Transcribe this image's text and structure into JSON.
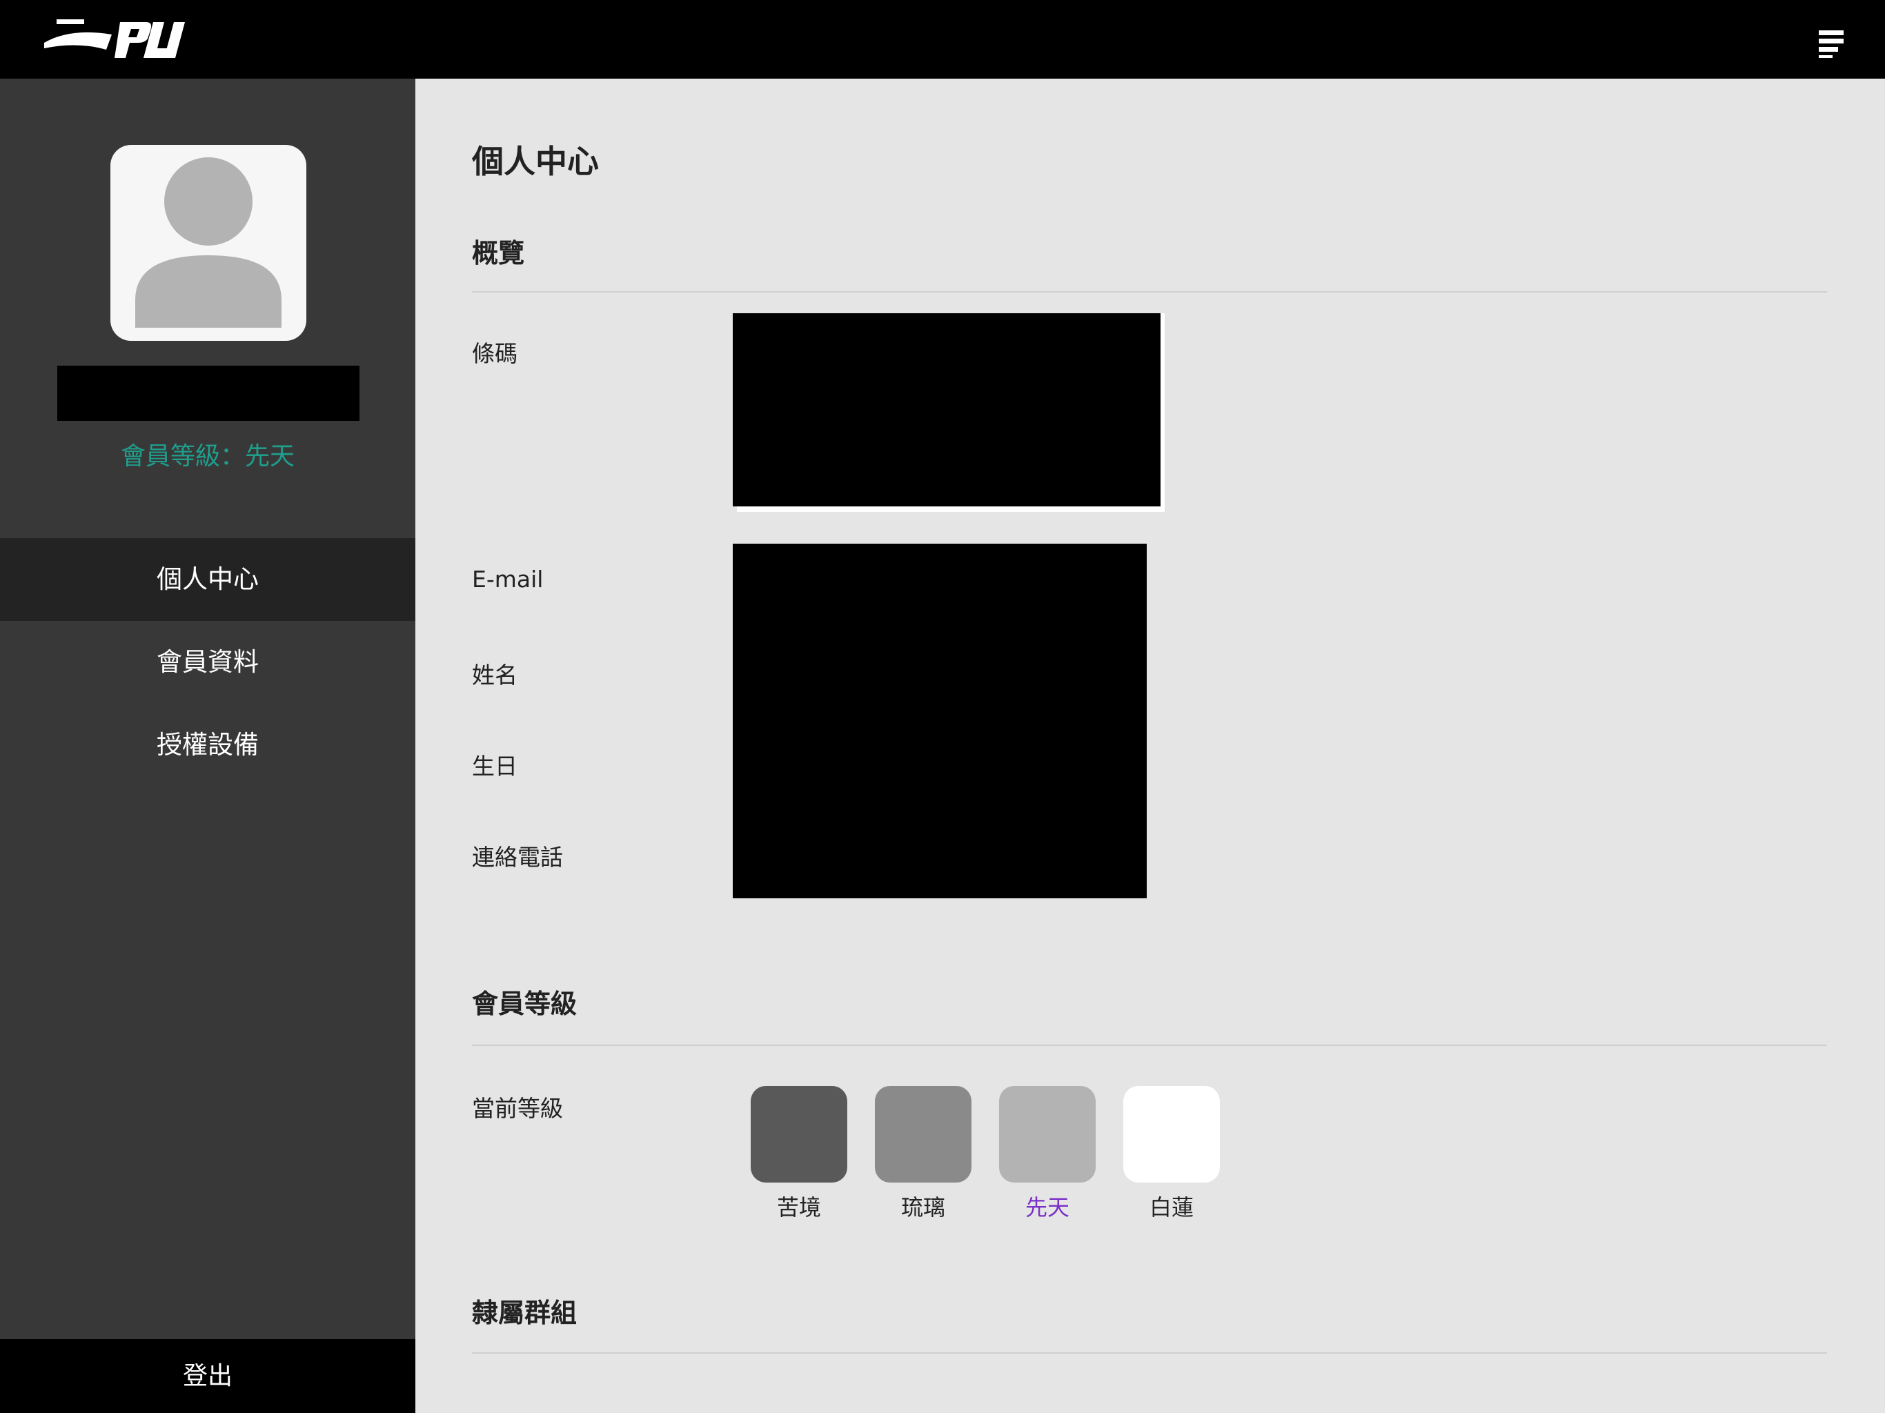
{
  "app": {
    "logo_name": "brand-logo",
    "menu_icon": "hamburger-menu-icon"
  },
  "sidebar": {
    "avatar_icon": "user-silhouette-icon",
    "member_level_text": "會員等級：先天",
    "nav": [
      {
        "label": "個人中心",
        "active": true
      },
      {
        "label": "會員資料",
        "active": false
      },
      {
        "label": "授權設備",
        "active": false
      }
    ],
    "logout_label": "登出"
  },
  "main": {
    "page_title": "個人中心",
    "overview": {
      "title": "概覽",
      "fields": [
        {
          "label": "條碼"
        },
        {
          "label": "E-mail"
        },
        {
          "label": "姓名"
        },
        {
          "label": "生日"
        },
        {
          "label": "連絡電話"
        }
      ]
    },
    "membership": {
      "title": "會員等級",
      "current_label": "當前等級",
      "current_tier": "先天",
      "tiers": [
        {
          "label": "苦境",
          "color": "#595959"
        },
        {
          "label": "琉璃",
          "color": "#8a8a8a"
        },
        {
          "label": "先天",
          "color": "#b3b3b3"
        },
        {
          "label": "白蓮",
          "color": "#ffffff"
        }
      ]
    },
    "groups": {
      "title": "隸屬群組"
    }
  },
  "colors": {
    "accent_teal": "#1f9e8c",
    "current_tier_purple": "#7b2fc9"
  }
}
